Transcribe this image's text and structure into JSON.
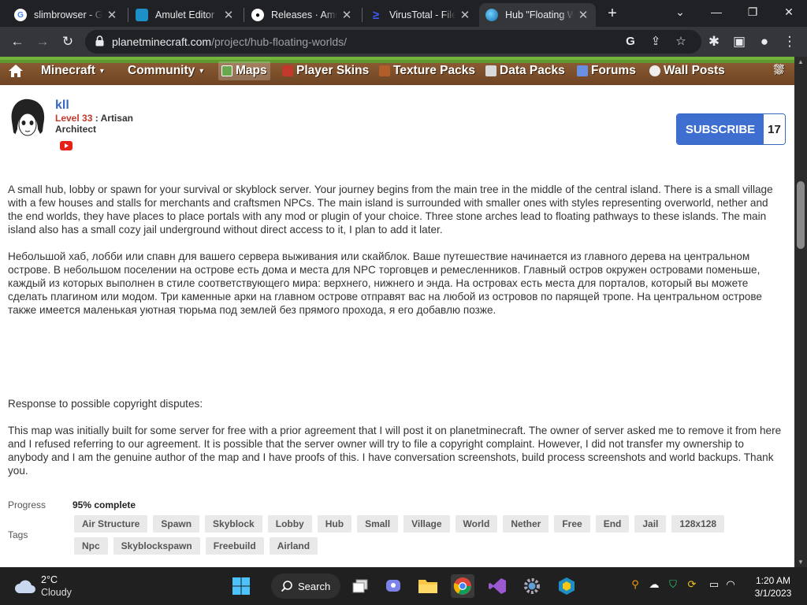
{
  "browser": {
    "tabs": [
      {
        "title": "slimbrowser - Go",
        "icon": "google-icon",
        "active": false
      },
      {
        "title": "Amulet Editor",
        "icon": "amulet-icon",
        "active": false
      },
      {
        "title": "Releases · Amule",
        "icon": "github-icon",
        "active": false
      },
      {
        "title": "VirusTotal - File",
        "icon": "virustotal-icon",
        "active": false
      },
      {
        "title": "Hub \"Floating W",
        "icon": "planetminecraft-icon",
        "active": true
      }
    ],
    "url_host": "planetminecraft.com",
    "url_path": "/project/hub-floating-worlds/"
  },
  "site_nav": {
    "items": [
      {
        "label": "Minecraft",
        "caret": "▾"
      },
      {
        "label": "Community",
        "caret": "▾"
      },
      {
        "label": "Maps"
      },
      {
        "label": "Player Skins"
      },
      {
        "label": "Texture Packs"
      },
      {
        "label": "Data Packs"
      },
      {
        "label": "Forums"
      },
      {
        "label": "Wall Posts"
      }
    ]
  },
  "author": {
    "name": "kll",
    "level_label": "Level 33",
    "level_title": ": Artisan",
    "rank": "Architect"
  },
  "subscribe": {
    "label": "SUBSCRIBE",
    "count": "17"
  },
  "description": {
    "en": "A small hub, lobby or spawn for your survival or skyblock server. Your journey begins from the main tree in the middle of the central island. There is a small village with a few houses and stalls for merchants and craftsmen NPCs. The main island is surrounded with smaller ones with styles representing overworld, nether and the end worlds, they have places to place portals with any mod or plugin of your choice. Three stone arches lead to floating pathways to these islands. The main island also has a small cozy jail underground without direct access to it, I plan to add it later.",
    "ru": "Небольшой хаб, лобби или спавн для вашего сервера выживания или скайблок. Ваше путешествие начинается из главного дерева на центральном острове. В небольшом поселении на острове есть дома и места для NPC торговцев и ремесленников. Главный остров окружен островами поменьше, каждый из которых выполнен в стиле соответствующего мира: верхнего, нижнего и энда. На островах есть места для порталов, который вы можете сделать плагином или модом. Три каменные арки на главном острове отправят вас на любой из островов по парящей тропе. На центральном острове также имеется маленькая уютная тюрьма под землей без прямого прохода, я его добавлю позже.",
    "copyright_heading": "Response to possible copyright disputes:",
    "copyright_body": "This map was initially built for some server for free with a prior agreement that I will post it on planetminecraft. The owner of server asked me to remove it from here and I refused referring to our agreement. It is possible that the server owner will try to file a copyright complaint. However, I did not transfer my ownership to anybody and I am the genuine author of the map and I have proofs of this. I have conversation screenshots, build process screenshots and world backups. Thank you."
  },
  "stats": {
    "progress_label": "Progress",
    "progress_value": "95% complete",
    "tags_label": "Tags",
    "tags": [
      "Air Structure",
      "Spawn",
      "Skyblock",
      "Lobby",
      "Hub",
      "Small",
      "Village",
      "World",
      "Nether",
      "Free",
      "End",
      "Jail",
      "128x128",
      "Npc",
      "Skyblockspawn",
      "Freebuild",
      "Airland"
    ]
  },
  "taskbar": {
    "weather_temp": "2°C",
    "weather_cond": "Cloudy",
    "search_label": "Search",
    "time": "1:20 AM",
    "date": "3/1/2023"
  }
}
